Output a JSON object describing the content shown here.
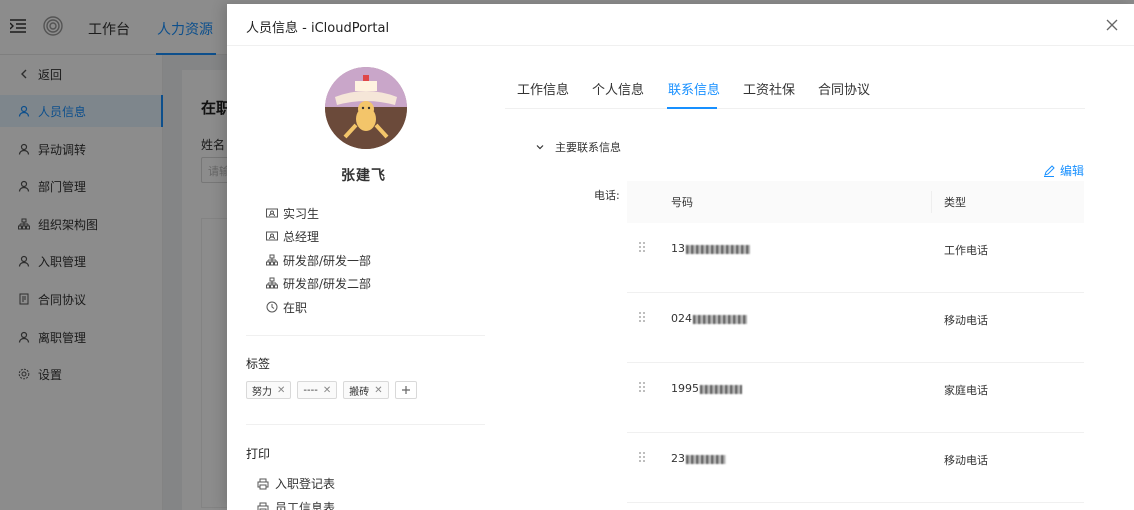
{
  "topbar": {
    "nav": [
      "工作台",
      "人力资源"
    ]
  },
  "sidebar": {
    "items": [
      {
        "label": "返回",
        "icon": "chevron-left-icon"
      },
      {
        "label": "人员信息",
        "icon": "user-icon",
        "active": true
      },
      {
        "label": "异动调转",
        "icon": "user-icon"
      },
      {
        "label": "部门管理",
        "icon": "user-icon"
      },
      {
        "label": "组织架构图",
        "icon": "org-chart-icon"
      },
      {
        "label": "入职管理",
        "icon": "user-icon"
      },
      {
        "label": "合同协议",
        "icon": "document-icon"
      },
      {
        "label": "离职管理",
        "icon": "user-icon"
      },
      {
        "label": "设置",
        "icon": "gear-icon"
      }
    ]
  },
  "background": {
    "title": "在职",
    "name_label": "姓名",
    "name_placeholder": "请输"
  },
  "drawer": {
    "title": "人员信息 - iCloudPortal",
    "employee": {
      "name": "张建飞",
      "info": [
        {
          "text": "实习生",
          "icon": "id-card-icon"
        },
        {
          "text": "总经理",
          "icon": "id-card-icon"
        },
        {
          "text": "研发部/研发一部",
          "icon": "org-chart-icon"
        },
        {
          "text": "研发部/研发二部",
          "icon": "org-chart-icon"
        },
        {
          "text": "在职",
          "icon": "clock-icon"
        }
      ]
    },
    "tags_title": "标签",
    "tags": [
      "努力",
      "----",
      "搬砖"
    ],
    "print_title": "打印",
    "print_items": [
      "入职登记表",
      "员工信息表"
    ],
    "tabs": [
      "工作信息",
      "个人信息",
      "联系信息",
      "工资社保",
      "合同协议"
    ],
    "active_tab": "联系信息",
    "section_title": "主要联系信息",
    "edit_label": "编辑",
    "phone_label": "电话:",
    "table": {
      "headers": [
        "号码",
        "类型"
      ],
      "rows": [
        {
          "number": "13",
          "type": "工作电话"
        },
        {
          "number": "024",
          "type": "移动电话"
        },
        {
          "number": "1995",
          "type": "家庭电话"
        },
        {
          "number": "23",
          "type": "移动电话"
        }
      ]
    }
  }
}
